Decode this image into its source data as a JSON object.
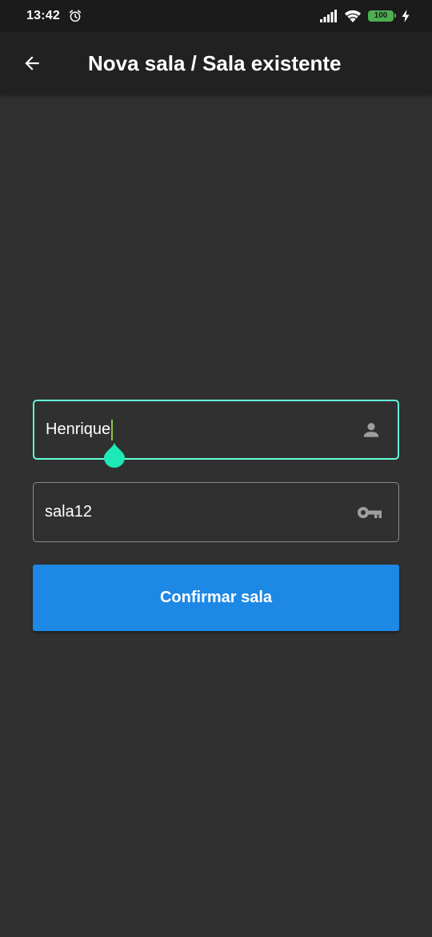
{
  "status_bar": {
    "time": "13:42",
    "battery_level": "100",
    "icons": [
      "alarm-icon",
      "signal-icon",
      "wifi-icon",
      "battery-icon",
      "charging-icon"
    ]
  },
  "app_bar": {
    "title": "Nova sala / Sala existente",
    "back_icon": "arrow-back-icon"
  },
  "form": {
    "name_field": {
      "value": "Henrique",
      "icon": "person-icon",
      "focused": true
    },
    "room_field": {
      "value": "sala12",
      "icon": "key-icon"
    },
    "confirm_label": "Confirmar sala"
  },
  "colors": {
    "background": "#303030",
    "app_bar": "#212121",
    "status_bar": "#1b1b1b",
    "focus_border": "#64ffda",
    "inactive_border": "#8a8a8a",
    "button": "#1e88e5",
    "battery": "#4caf50",
    "caret": "#8bc34a",
    "cursor_handle": "#1de9b6",
    "icon_gray": "#9e9e9e"
  }
}
